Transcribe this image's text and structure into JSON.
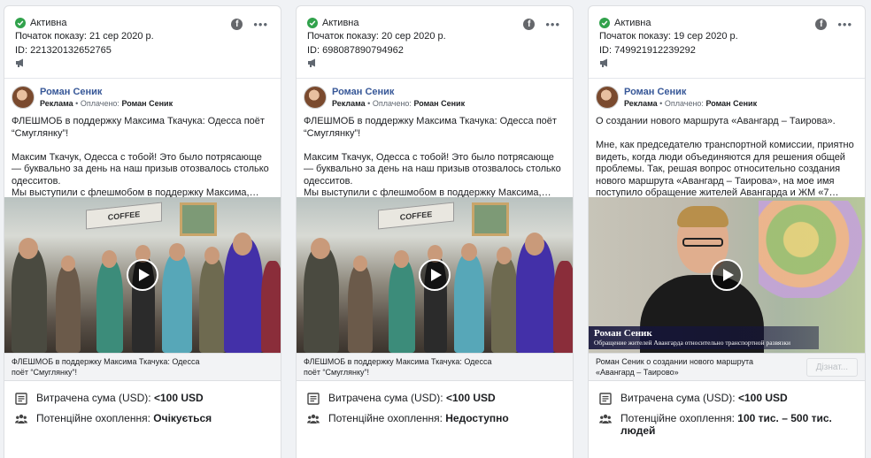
{
  "cards": [
    {
      "status": "Активна",
      "start_date": "Початок показу: 21 сер 2020 р.",
      "id": "ID: 221320132652765",
      "page_name": "Роман Сеник",
      "sponsored": "Реклама",
      "paid_by_label": "Оплачено:",
      "paid_by": "Роман Сеник",
      "text": "ФЛЕШМОБ в поддержку Максима Ткачука: Одесса поёт “Смуглянку”!\n\nМаксим Ткачук, Одесса с тобой! Это было потрясающе — буквально за день на наш призыв отозвалось столько одесситов.\nМы выступили с флешмобом в поддержку Максима,…",
      "media_type": "crowd",
      "coffee_sign": "COFFEE",
      "caption": "ФЛЕШМОБ в поддержку Максима Ткачука: Одесса поёт “Смуглянку”!",
      "spend_label": "Витрачена сума (USD):",
      "spend_value": "<100 USD",
      "reach_label": "Потенційне охоплення:",
      "reach_value": "Очікується"
    },
    {
      "status": "Активна",
      "start_date": "Початок показу: 20 сер 2020 р.",
      "id": "ID: 698087890794962",
      "page_name": "Роман Сеник",
      "sponsored": "Реклама",
      "paid_by_label": "Оплачено:",
      "paid_by": "Роман Сеник",
      "text": "ФЛЕШМОБ в поддержку Максима Ткачука: Одесса поёт “Смуглянку”!\n\nМаксим Ткачук, Одесса с тобой! Это было потрясающе — буквально за день на наш призыв отозвалось столько одесситов.\nМы выступили с флешмобом в поддержку Максима,…",
      "media_type": "crowd",
      "coffee_sign": "COFFEE",
      "caption": "ФЛЕШМОБ в поддержку Максима Ткачука: Одесса поёт “Смуглянку”!",
      "spend_label": "Витрачена сума (USD):",
      "spend_value": "<100 USD",
      "reach_label": "Потенційне охоплення:",
      "reach_value": "Недоступно"
    },
    {
      "status": "Активна",
      "start_date": "Початок показу: 19 сер 2020 р.",
      "id": "ID: 749921912239292",
      "page_name": "Роман Сеник",
      "sponsored": "Реклама",
      "paid_by_label": "Оплачено:",
      "paid_by": "Роман Сеник",
      "text": "О создании нового маршрута «Авангард – Таирова».\n\nМне, как председателю транспортной комиссии, приятно видеть, когда люди объединяются для решения общей проблемы. Так, решая вопрос относительно создания нового маршрута «Авангард – Таирова», на мое имя поступило обращение жителей Авангарда и ЖМ «7…",
      "media_type": "office",
      "lower_third_name": "Роман Сеник",
      "lower_third_desc": "Обращение жителей Авангарда относительно транспортной развязки",
      "caption": "Роман Сеник о создании нового маршрута «Авангард – Таирово»",
      "cta_label": "Дізнат...",
      "spend_label": "Витрачена сума (USD):",
      "spend_value": "<100 USD",
      "reach_label": "Потенційне охоплення:",
      "reach_value": "100 тис. – 500 тис. людей"
    }
  ],
  "icons": {
    "status": "check-circle-icon",
    "platform": "facebook-icon",
    "menu": "more-options-icon",
    "placement": "megaphone-icon",
    "spend": "receipt-icon",
    "reach": "people-icon",
    "video": "play-icon"
  },
  "colors": {
    "active_green": "#31a24c",
    "link_blue": "#385898"
  }
}
